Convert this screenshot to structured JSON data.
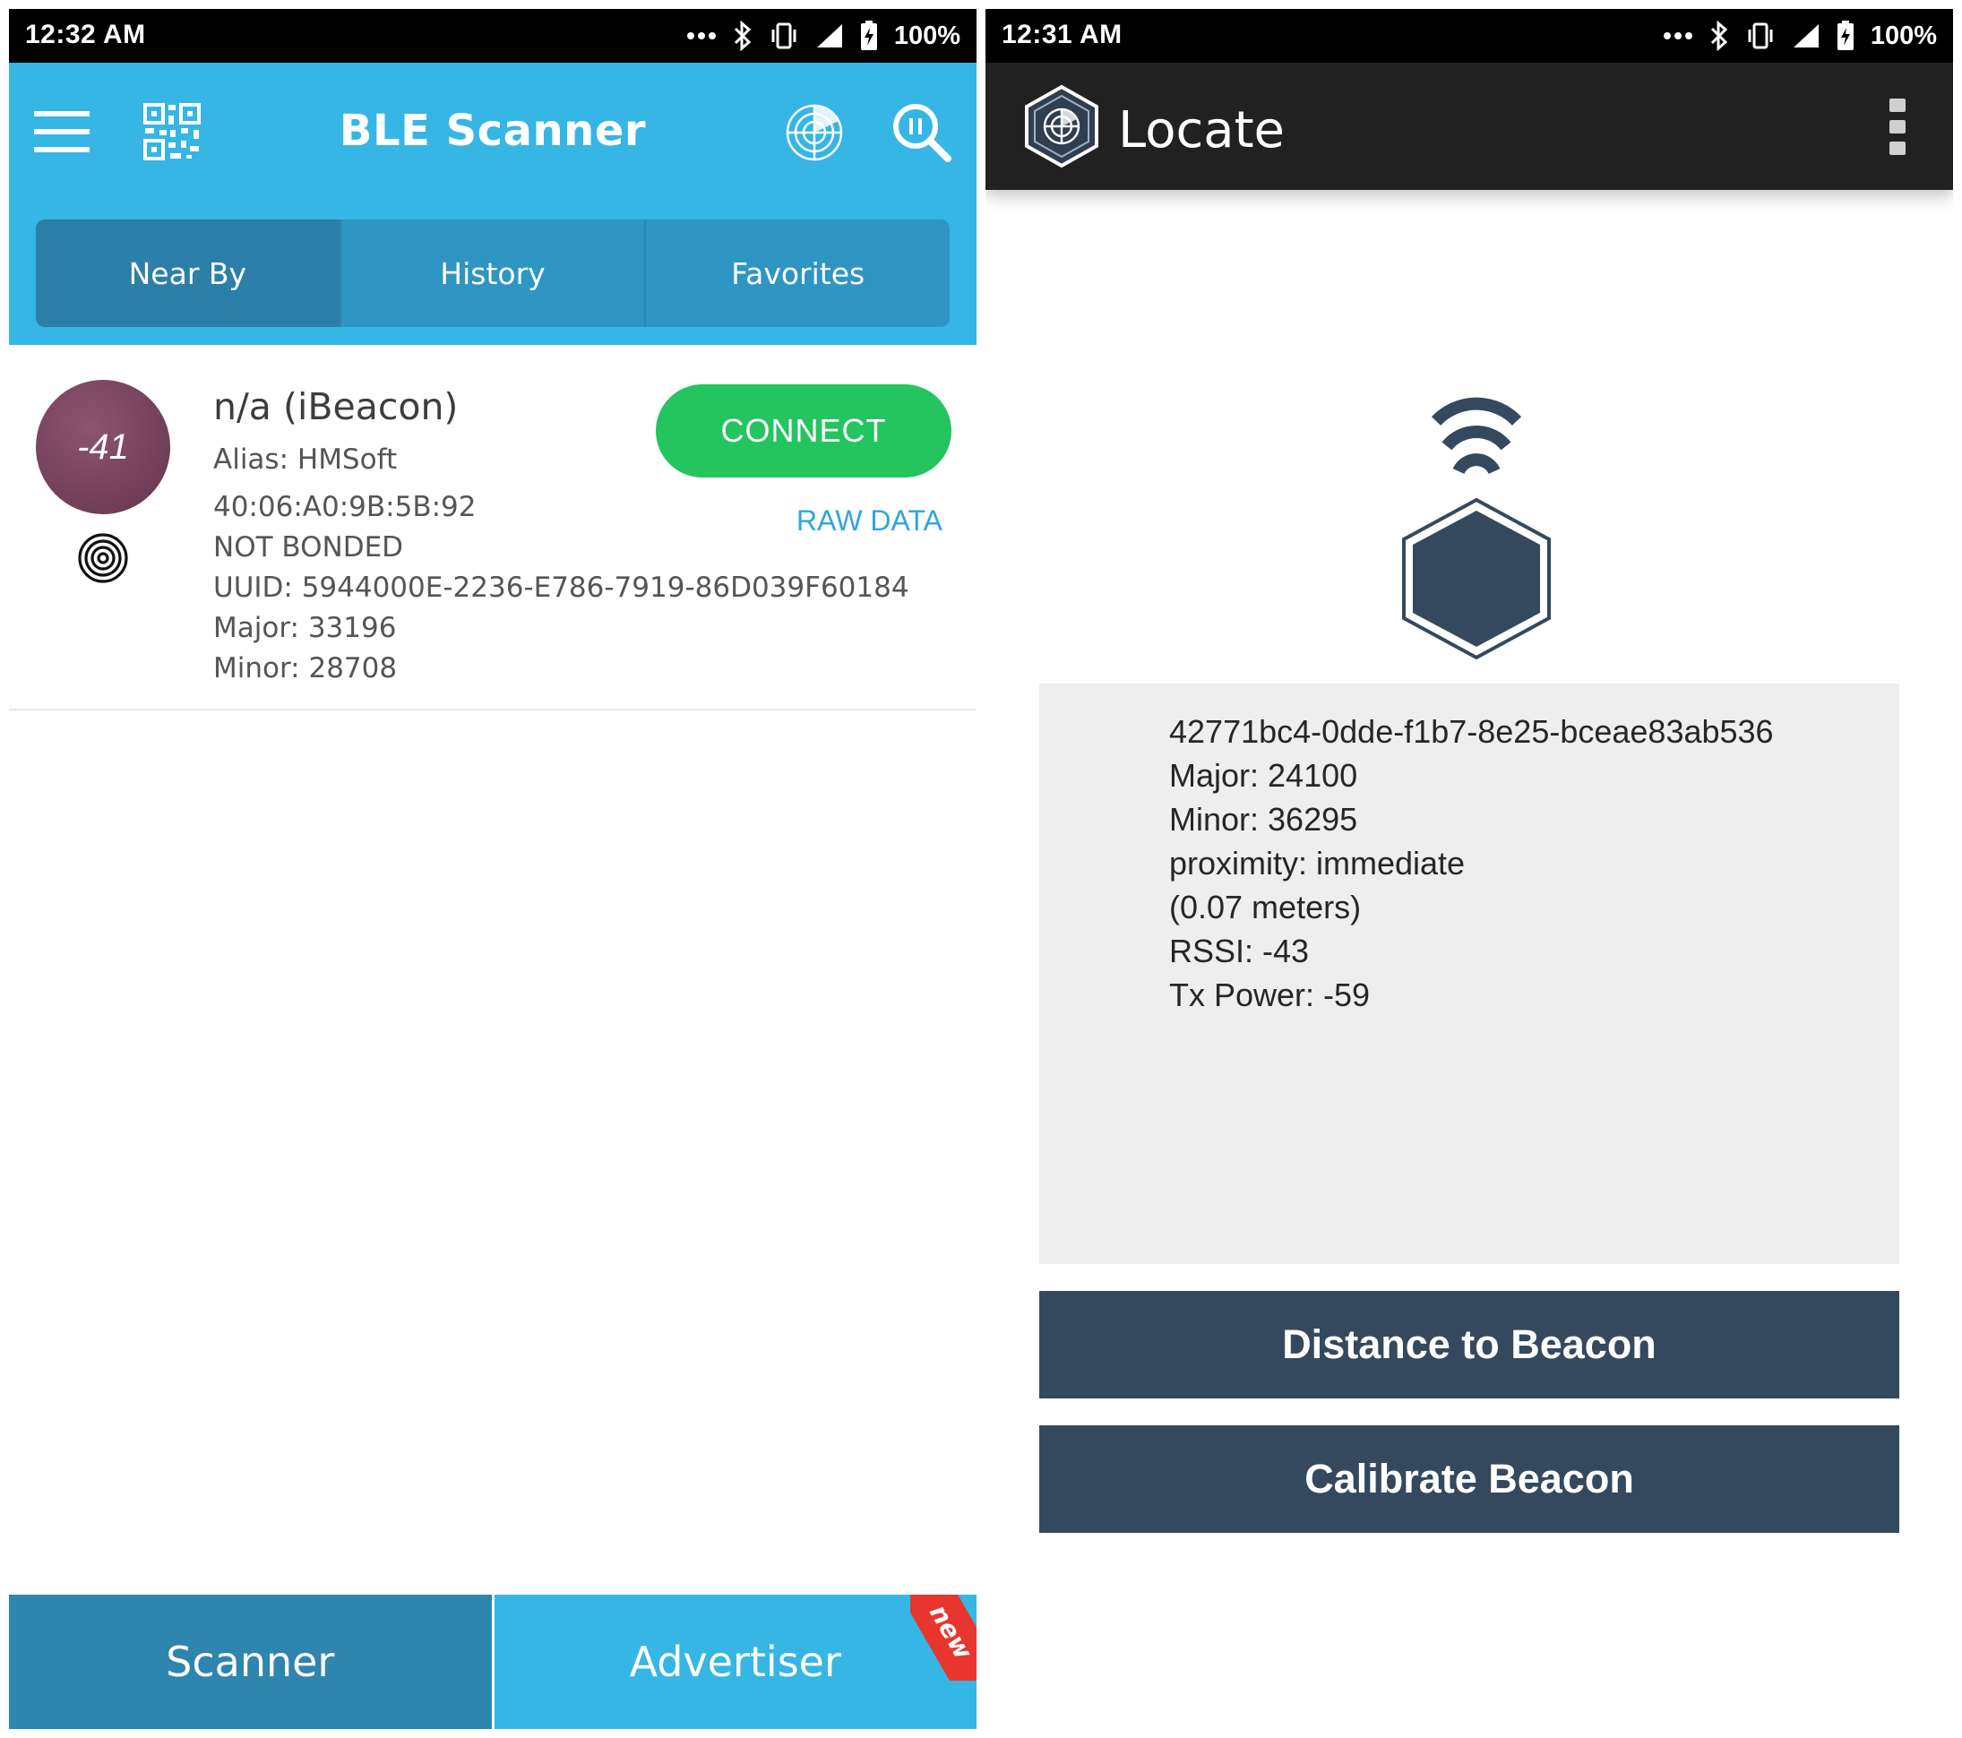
{
  "left": {
    "status": {
      "time": "12:32 AM",
      "battery": "100%"
    },
    "header": {
      "title": "BLE Scanner"
    },
    "tabs": [
      {
        "label": "Near By",
        "active": true
      },
      {
        "label": "History"
      },
      {
        "label": "Favorites"
      }
    ],
    "device": {
      "rssi": "-41",
      "name": "n/a (iBeacon)",
      "alias": "Alias: HMSoft",
      "mac": "40:06:A0:9B:5B:92",
      "bond": "NOT BONDED",
      "uuid": "UUID: 5944000E-2236-E786-7919-86D039F60184",
      "major": "Major: 33196",
      "minor": "Minor: 28708",
      "connect_label": "CONNECT",
      "raw_label": "RAW DATA"
    },
    "bottom": {
      "scanner": "Scanner",
      "advertiser": "Advertiser",
      "badge": "new"
    }
  },
  "right": {
    "status": {
      "time": "12:31 AM",
      "battery": "100%"
    },
    "toolbar": {
      "title": "Locate"
    },
    "info": [
      "42771bc4-0dde-f1b7-8e25-bceae83ab536",
      "Major: 24100",
      "Minor: 36295",
      "proximity: immediate",
      "(0.07 meters)",
      "RSSI: -43",
      "Tx Power: -59"
    ],
    "buttons": {
      "distance": "Distance to Beacon",
      "calibrate": "Calibrate Beacon"
    }
  },
  "colors": {
    "ble_header": "#35b6e5",
    "tab_active": "#2b7fa8",
    "connect_green": "#24c45f",
    "rssi_circle": "#7a4560",
    "locate_toolbar": "#212121",
    "locate_button": "#34495e",
    "new_badge": "#e8362e"
  },
  "icons": [
    "hamburger-icon",
    "qr-code-icon",
    "radar-icon",
    "search-icon",
    "beacon-signal-icon",
    "locate-logo-icon",
    "overflow-menu-icon",
    "beacon-hexagon-icon"
  ]
}
